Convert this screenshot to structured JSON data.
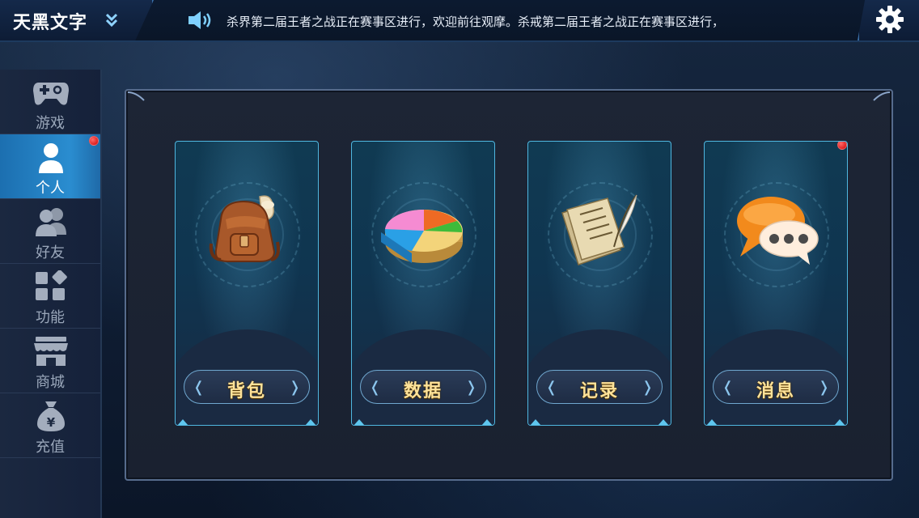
{
  "app": {
    "title": "天黑文字"
  },
  "notice": {
    "text": "杀界第二届王者之战正在赛事区进行，欢迎前往观摩。杀戒第二届王者之战正在赛事区进行，"
  },
  "sidebar": {
    "items": [
      {
        "label": "游戏",
        "icon": "gamepad-icon",
        "active": false,
        "badge": false
      },
      {
        "label": "个人",
        "icon": "person-icon",
        "active": true,
        "badge": true
      },
      {
        "label": "好友",
        "icon": "friends-icon",
        "active": false,
        "badge": false
      },
      {
        "label": "功能",
        "icon": "grid-icon",
        "active": false,
        "badge": false
      },
      {
        "label": "商城",
        "icon": "shop-icon",
        "active": false,
        "badge": false
      },
      {
        "label": "充值",
        "icon": "money-bag-icon",
        "active": false,
        "badge": false
      }
    ]
  },
  "cards": [
    {
      "label": "背包",
      "icon": "backpack-icon",
      "badge": false
    },
    {
      "label": "数据",
      "icon": "pie-chart-icon",
      "badge": false
    },
    {
      "label": "记录",
      "icon": "scroll-quill-icon",
      "badge": false
    },
    {
      "label": "消息",
      "icon": "chat-bubble-icon",
      "badge": true
    }
  ],
  "colors": {
    "active_tab": "#2a8dd0",
    "card_border": "#4fb7e0",
    "button_text": "#ffe39a",
    "badge": "#d10000"
  }
}
